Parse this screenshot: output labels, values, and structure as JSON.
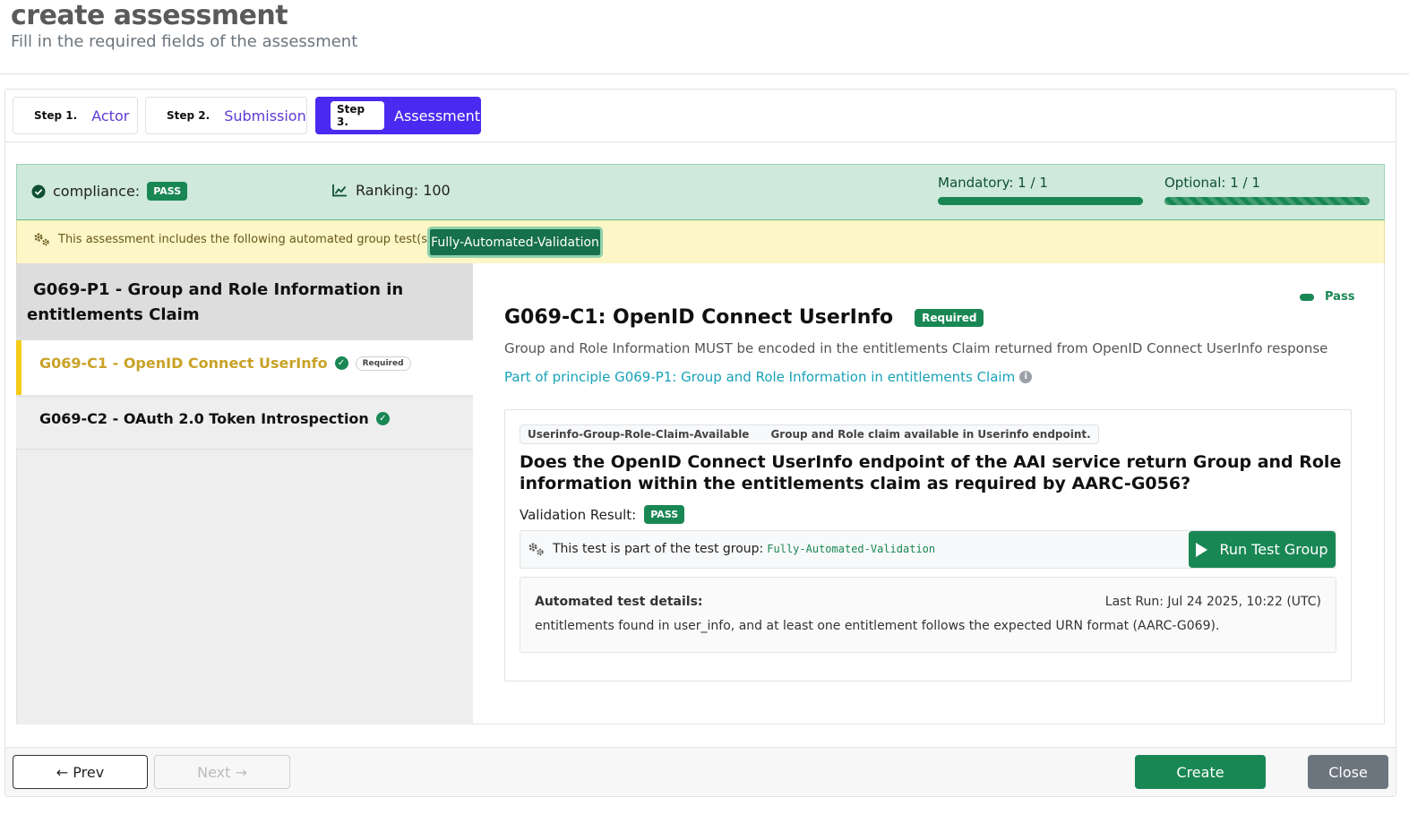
{
  "header": {
    "title": "create assessment",
    "subtitle": "Fill in the required fields of the assessment"
  },
  "steps": [
    {
      "num": "Step 1.",
      "label": "Actor"
    },
    {
      "num": "Step 2.",
      "label": "Submission"
    },
    {
      "num": "Step 3.",
      "label": "Assessment"
    }
  ],
  "status": {
    "compliance_label": "compliance:",
    "compliance_badge": "PASS",
    "ranking": "Ranking: 100",
    "mandatory": {
      "label": "Mandatory: 1 / 1",
      "fraction": 1.0
    },
    "optional": {
      "label": "Optional: 1 / 1",
      "fraction": 1.0
    }
  },
  "automation": {
    "text": "This assessment includes the following automated group test(s):",
    "group_button": "Fully-Automated-Validation"
  },
  "sidebar": {
    "principle": "G069-P1 - Group and Role Information in entitlements Claim",
    "criteria": [
      {
        "label": "G069-C1 - OpenID Connect UserInfo",
        "badge": "Required"
      },
      {
        "label": "G069-C2 - OAuth 2.0 Token Introspection"
      }
    ]
  },
  "criterion": {
    "status": "Pass",
    "title": "G069-C1: OpenID Connect UserInfo",
    "badge": "Required",
    "description": "Group and Role Information MUST be encoded in the entitlements Claim returned from OpenID Connect UserInfo response",
    "principle_link": "Part of principle G069-P1: Group and Role Information in entitlements Claim"
  },
  "metric": {
    "tag_name": "Userinfo-Group-Role-Claim-Available",
    "tag_desc": "Group and Role claim available in Userinfo endpoint.",
    "question": "Does the OpenID Connect UserInfo endpoint of the AAI service return Group and Role information within the entitlements claim as required by AARC-G056?",
    "validation_label": "Validation Result:",
    "validation_badge": "PASS",
    "test_group_text": "This test is part of the test group:",
    "test_group_name": "Fully-Automated-Validation",
    "run_button": "Run Test Group",
    "details_title": "Automated test details:",
    "last_run": "Last Run: Jul 24 2025, 10:22 (UTC)",
    "details_text": "entitlements found in user_info, and at least one entitlement follows the expected URN format (AARC-G069)."
  },
  "footer": {
    "prev": "← Prev",
    "next": "Next →",
    "create": "Create",
    "close": "Close"
  },
  "colors": {
    "primary": "#4a2af0",
    "success": "#198754",
    "warning_bg": "#fdf6c7",
    "status_bg": "#cfe9dc",
    "active_marker": "#f4cc19",
    "secondary": "#6c757d"
  }
}
